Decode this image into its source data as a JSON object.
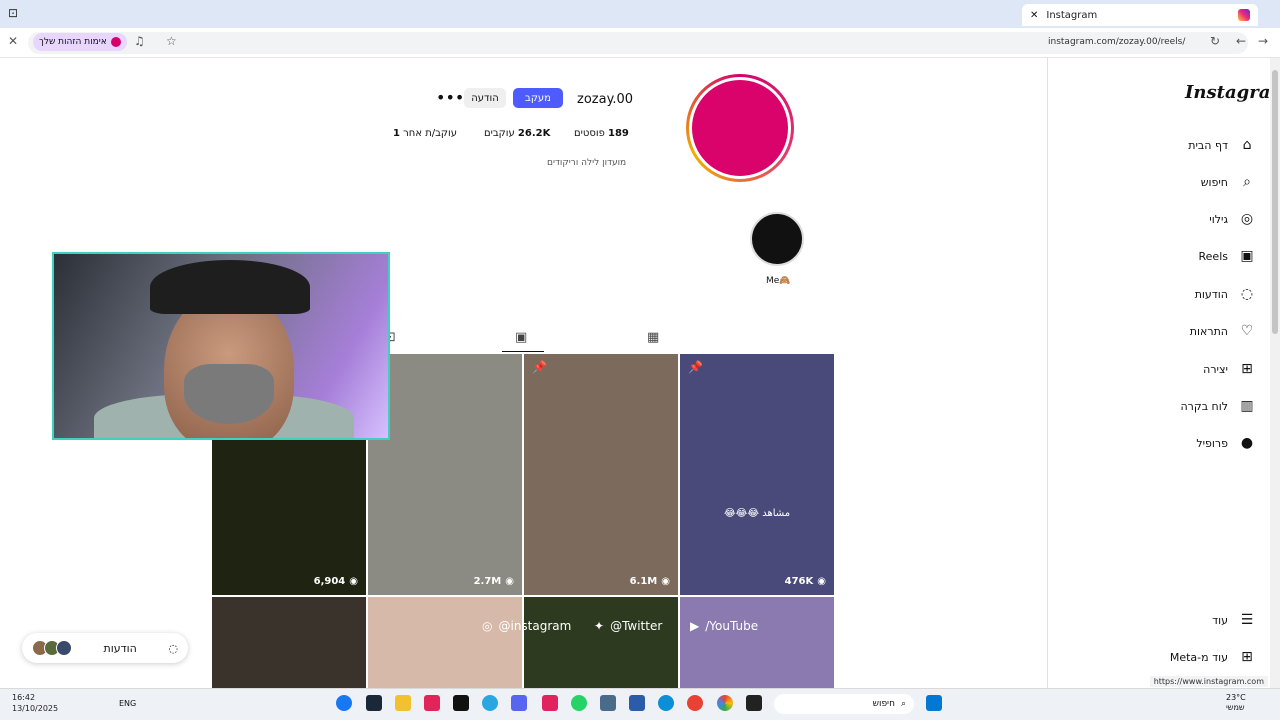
{
  "browser": {
    "tab_title": "Instagram",
    "url": "instagram.com/zozay.00/reels/",
    "verify_label": "אימות הזהות שלך",
    "status_url": "https://www.instagram.com"
  },
  "sidebar": {
    "logo": "Instagram",
    "items": [
      {
        "label": "דף הבית",
        "icon": "⌂"
      },
      {
        "label": "חיפוש",
        "icon": "⌕"
      },
      {
        "label": "גילוי",
        "icon": "◎"
      },
      {
        "label": "Reels",
        "icon": "▣"
      },
      {
        "label": "הודעות",
        "icon": "◌"
      },
      {
        "label": "התראות",
        "icon": "♡"
      },
      {
        "label": "יצירה",
        "icon": "⊞"
      },
      {
        "label": "לוח בקרה",
        "icon": "▥"
      },
      {
        "label": "פרופיל",
        "icon": "●"
      }
    ],
    "more": {
      "label": "עוד",
      "icon": "☰"
    },
    "meta": {
      "label": "עוד מ-Meta",
      "icon": "⊞"
    }
  },
  "profile": {
    "username": "zozay.00",
    "follow_label": "מעקב",
    "message_label": "הודעה",
    "more_label": "•••",
    "posts_count": "189",
    "posts_label": "פוסטים",
    "followers_count": "26.2K",
    "followers_label": "עוקבים",
    "following_count": "1",
    "following_label": "עוקב/ת אחר",
    "bio": "מועדון לילה וריקודים",
    "highlight_label": "Me🙈"
  },
  "grid": [
    {
      "views": "6,904",
      "pinned": false,
      "color": "#1f2412"
    },
    {
      "views": "2.7M",
      "pinned": false,
      "color": "#8b8b83"
    },
    {
      "views": "6.1M",
      "pinned": true,
      "color": "#7c6b5c"
    },
    {
      "views": "476K",
      "pinned": true,
      "color": "#4a4a7a",
      "caption": "😂😂😂 مشاهد"
    },
    {
      "views": "",
      "pinned": false,
      "color": "#3a332c"
    },
    {
      "views": "",
      "pinned": false,
      "color": "#d6b9a8"
    },
    {
      "views": "",
      "pinned": false,
      "color": "#2e3a1f"
    },
    {
      "views": "",
      "pinned": false,
      "color": "#8a7ab0"
    }
  ],
  "social": {
    "instagram": "@instagram",
    "twitter": "@Twitter",
    "youtube": "/YouTube"
  },
  "messages_pill": {
    "label": "הודעות"
  },
  "taskbar": {
    "time": "16:42",
    "date": "13/10/2025",
    "lang": "ENG",
    "search_placeholder": "חיפוש",
    "temp": "23°C",
    "weather_text": "שמשי"
  }
}
